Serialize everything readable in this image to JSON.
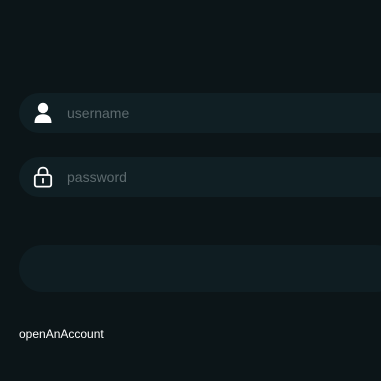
{
  "login": {
    "username": {
      "value": "",
      "placeholder": "username",
      "icon": "user-icon"
    },
    "password": {
      "value": "",
      "placeholder": "password",
      "icon": "lock-icon"
    },
    "submit_label": "",
    "open_account_link": "openAnAccount"
  },
  "colors": {
    "background": "#0c1518",
    "field": "#101f24",
    "button": "#0f1d22",
    "placeholder": "#5d6a6e",
    "icon": "#ffffff"
  }
}
